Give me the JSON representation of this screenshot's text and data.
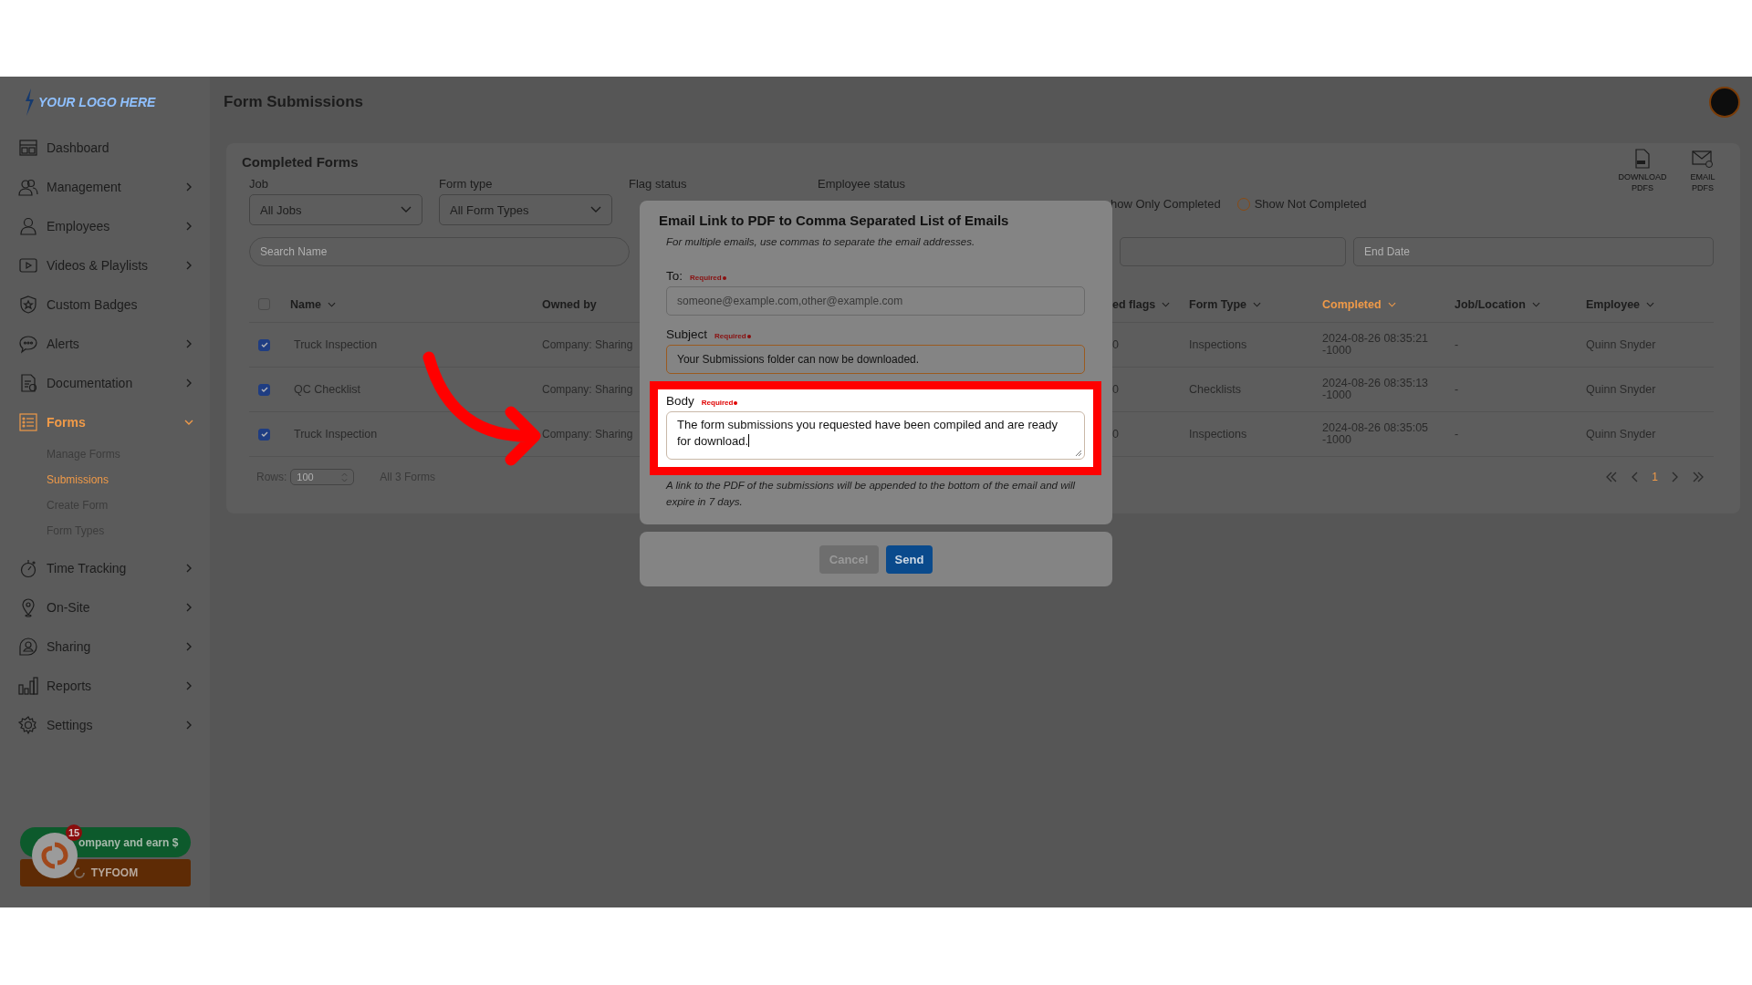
{
  "sidebar": {
    "logo": "YOUR LOGO HERE",
    "items": [
      {
        "label": "Dashboard",
        "has_submenu": false,
        "selected": false
      },
      {
        "label": "Management",
        "has_submenu": true,
        "expanded": false,
        "selected": false
      },
      {
        "label": "Employees",
        "has_submenu": true,
        "expanded": false,
        "selected": false
      },
      {
        "label": "Videos & Playlists",
        "has_submenu": true,
        "expanded": false,
        "selected": false
      },
      {
        "label": "Custom Badges",
        "has_submenu": false,
        "selected": false
      },
      {
        "label": "Alerts",
        "has_submenu": true,
        "expanded": false,
        "selected": false
      },
      {
        "label": "Documentation",
        "has_submenu": true,
        "expanded": false,
        "selected": false
      },
      {
        "label": "Forms",
        "has_submenu": true,
        "expanded": true,
        "selected": true,
        "children": [
          {
            "label": "Manage Forms",
            "selected": false
          },
          {
            "label": "Submissions",
            "selected": true
          },
          {
            "label": "Create Form",
            "selected": false
          },
          {
            "label": "Form Types",
            "selected": false
          }
        ]
      },
      {
        "label": "Time Tracking",
        "has_submenu": true,
        "expanded": false,
        "selected": false
      },
      {
        "label": "On-Site",
        "has_submenu": true,
        "expanded": false,
        "selected": false
      },
      {
        "label": "Sharing",
        "has_submenu": true,
        "expanded": false,
        "selected": false
      },
      {
        "label": "Reports",
        "has_submenu": true,
        "expanded": false,
        "selected": false
      },
      {
        "label": "Settings",
        "has_submenu": true,
        "expanded": false,
        "selected": false
      }
    ],
    "promo": {
      "text": "ompany and earn $",
      "button": "TYFOOM"
    },
    "chat_bubble": {
      "badge": "15"
    }
  },
  "header": {
    "title": "Form Submissions"
  },
  "card": {
    "title": "Completed Forms",
    "actions": [
      {
        "label": "DOWNLOAD PDFS"
      },
      {
        "label": "EMAIL PDFS"
      }
    ],
    "filters": [
      {
        "label": "Job",
        "value": "All Jobs"
      },
      {
        "label": "Form type",
        "value": "All Form Types"
      },
      {
        "label": "Flag status"
      },
      {
        "label": "Employee status"
      }
    ],
    "radios": [
      {
        "label": "how Only Completed"
      },
      {
        "label": "Show Not Completed",
        "selected": false
      }
    ],
    "search": {
      "placeholder": "Search Name"
    },
    "end_date": {
      "placeholder": "End Date"
    }
  },
  "table": {
    "select_all": {
      "checked": false
    },
    "columns": [
      {
        "label": "Name",
        "sortable": true,
        "active": false
      },
      {
        "label": "Owned by",
        "sortable": false,
        "active": false
      },
      {
        "label": "ed flags",
        "sortable": true,
        "active": false
      },
      {
        "label": "Form Type",
        "sortable": true,
        "active": false
      },
      {
        "label": "Completed",
        "sortable": true,
        "active": true
      },
      {
        "label": "Job/Location",
        "sortable": true,
        "active": false
      },
      {
        "label": "Employee",
        "sortable": true,
        "active": false
      }
    ],
    "rows": [
      {
        "checked": true,
        "name": "Truck Inspection",
        "owned_by": "Company: Sharing",
        "flags": "0",
        "form_type": "Inspections",
        "completed": "2024-08-26 08:35:21 -1000",
        "job_location": "-",
        "employee": "Quinn Snyder"
      },
      {
        "checked": true,
        "name": "QC Checklist",
        "owned_by": "Company: Sharing",
        "flags": "0",
        "form_type": "Checklists",
        "completed": "2024-08-26 08:35:13 -1000",
        "job_location": "-",
        "employee": "Quinn Snyder"
      },
      {
        "checked": true,
        "name": "Truck Inspection",
        "owned_by": "Company: Sharing",
        "flags": "0",
        "form_type": "Inspections",
        "completed": "2024-08-26 08:35:05 -1000",
        "job_location": "-",
        "employee": "Quinn Snyder"
      }
    ],
    "rows_label": "Rows:",
    "rows_value": "100",
    "count": "All 3 Forms",
    "pages": [
      {
        "label": "1",
        "selected": true
      }
    ]
  },
  "modal": {
    "title": "Email Link to PDF to Comma Separated List of Emails",
    "subtitle": "For multiple emails, use commas to separate the email addresses.",
    "fields": [
      {
        "kind": "input",
        "label": "To:",
        "required": "Required",
        "placeholder": "someone@example.com,other@example.com",
        "accent_border": false,
        "spotlight": false
      },
      {
        "kind": "input",
        "label": "Subject",
        "required": "Required",
        "value": "Your Submissions folder can now be downloaded.",
        "accent_border": true,
        "spotlight": false
      },
      {
        "kind": "textarea",
        "label": "Body",
        "required": "Required",
        "value": "The form submissions you requested have been compiled and are ready for download.",
        "accent_border": false,
        "spotlight": true
      }
    ],
    "note": "A link to the PDF of the submissions will be appended to the bottom of the email and will expire in 7 days.",
    "buttons": [
      {
        "label": "Cancel",
        "kind": "secondary"
      },
      {
        "label": "Send",
        "kind": "primary"
      }
    ]
  }
}
